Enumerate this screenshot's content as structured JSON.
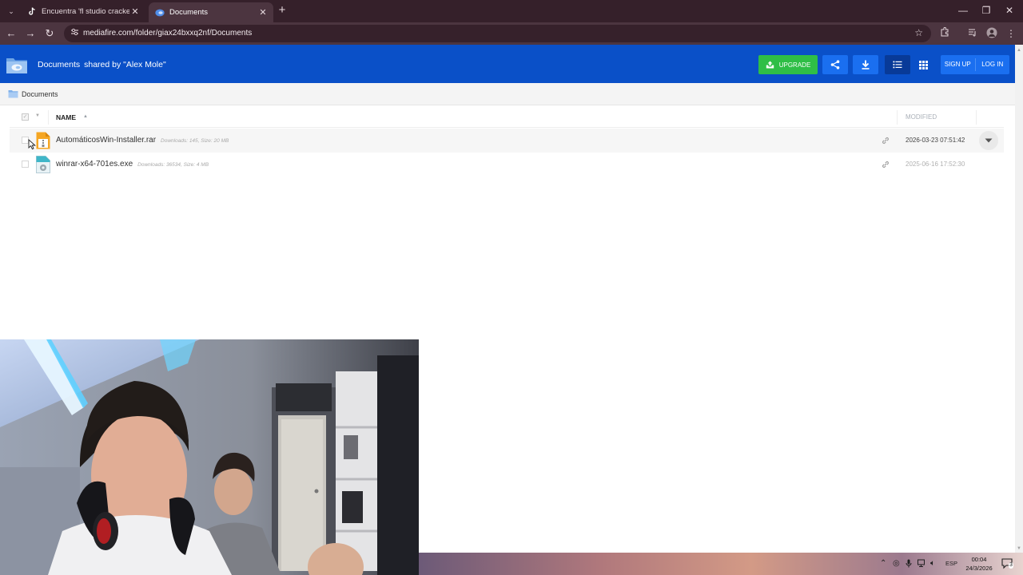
{
  "browser": {
    "tabs": [
      {
        "title": "Encuentra 'fl studio crackedo' e",
        "active": false
      },
      {
        "title": "Documents",
        "active": true
      }
    ],
    "url": "mediafire.com/folder/giax24bxxq2nf/Documents"
  },
  "header": {
    "folder_name": "Documents",
    "shared_by": "shared by \"Alex Mole\"",
    "upgrade_label": "UPGRADE",
    "sign_up_label": "SIGN UP",
    "log_in_label": "LOG IN",
    "brand_color": "#0a50c8",
    "upgrade_color": "#2fbe46"
  },
  "breadcrumb": {
    "label": "Documents"
  },
  "file_list": {
    "columns": {
      "name": "NAME",
      "modified": "MODIFIED"
    },
    "files": [
      {
        "name": "AutomáticosWin-Installer.rar",
        "meta": "Downloads: 145, Size: 20 MB",
        "modified": "2026-03-23 07:51:42",
        "icon": "archive-file-icon"
      },
      {
        "name": "winrar-x64-701es.exe",
        "meta": "Downloads: 36534, Size: 4 MB",
        "modified": "2025-06-16 17:52:30",
        "icon": "executable-file-icon"
      }
    ]
  },
  "taskbar": {
    "language": "ESP",
    "time": "00:04",
    "date": "24/3/2026",
    "notification_count": "3"
  }
}
